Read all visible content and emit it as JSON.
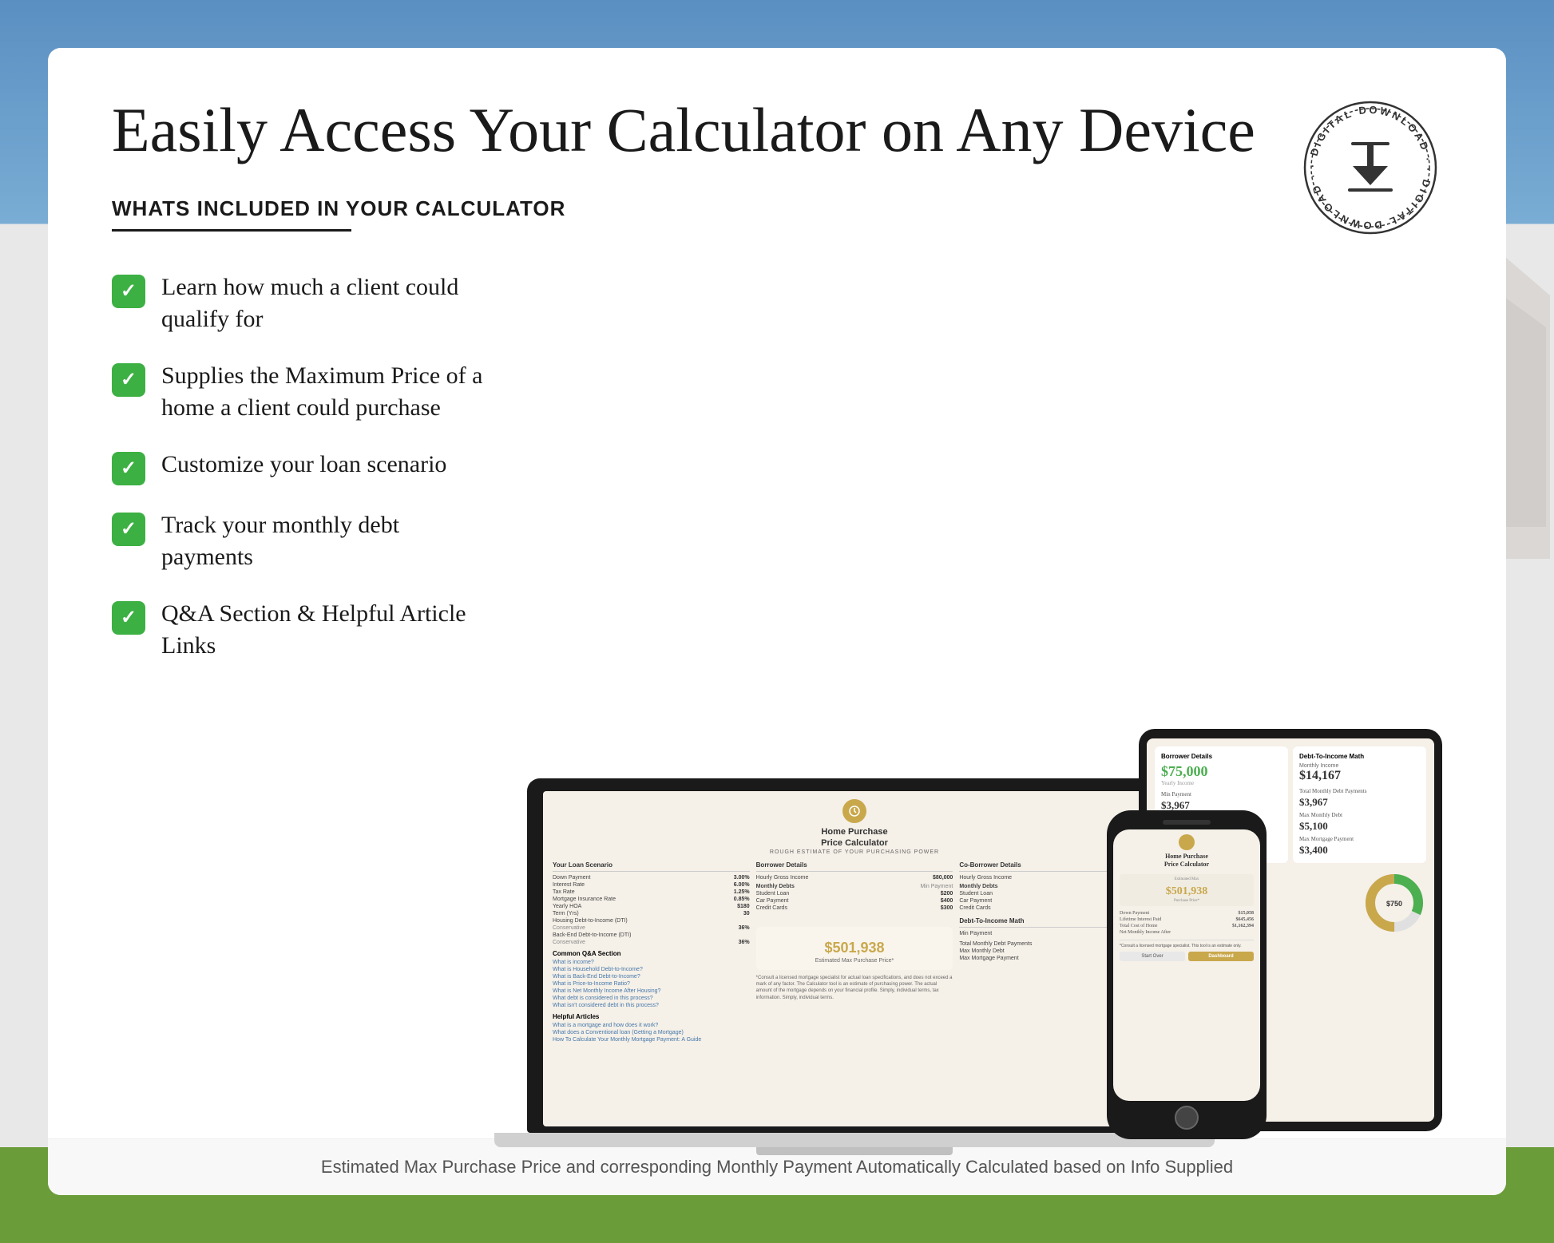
{
  "page": {
    "background": {
      "sky_color": "#5a8fc2",
      "card_bg": "#ffffff"
    },
    "headline": "Easily Access Your Calculator on Any Device",
    "section_title": "WHATS INCLUDED IN YOUR CALCULATOR",
    "features": [
      {
        "id": 1,
        "text": "Learn how much a client could qualify for"
      },
      {
        "id": 2,
        "text": "Supplies the Maximum Price of a home a client could purchase"
      },
      {
        "id": 3,
        "text": "Customize your loan scenario"
      },
      {
        "id": 4,
        "text": "Track your monthly debt payments"
      },
      {
        "id": 5,
        "text": "Q&A Section & Helpful Article Links"
      }
    ],
    "footer_note": "Estimated Max Purchase Price and corresponding Monthly Payment Automatically Calculated based on Info Supplied",
    "badge": {
      "text": "DIGITAL DOWNLOAD",
      "icon": "download"
    },
    "calculator": {
      "title": "Home Purchase Price Calculator",
      "subtitle": "ROUGH ESTIMATE OF YOUR PURCHASING POWER",
      "estimated_price": "$501,938",
      "estimated_label": "Estimated Max Purchase Price*",
      "sections": {
        "loan": {
          "title": "Your Loan Scenario",
          "rows": [
            {
              "label": "Down Payment",
              "value": "3.00%"
            },
            {
              "label": "Interest Rate",
              "value": "6.00%"
            },
            {
              "label": "Tax Rate",
              "value": "1.25%"
            },
            {
              "label": "Mortgage Insurance Rate",
              "value": "0.85%"
            },
            {
              "label": "Yearly HOA",
              "value": "$180"
            },
            {
              "label": "Term (Yrs)",
              "value": "30"
            },
            {
              "label": "Housing Debt-to-Income (DTI)",
              "value": "Conservative 36%"
            },
            {
              "label": "Back-End Debt-to-Income (DTI)",
              "value": "Conservative 36%"
            }
          ]
        },
        "borrower": {
          "title": "Borrower Details",
          "rows": [
            {
              "label": "Hourly Gross Income",
              "value": "$80,000"
            },
            {
              "label": "Monthly Debts",
              "value": ""
            },
            {
              "label": "Student Loan",
              "value": "$200"
            },
            {
              "label": "Car Payment",
              "value": "$400"
            },
            {
              "label": "Credit Cards",
              "value": "$300"
            }
          ]
        },
        "coborrower": {
          "title": "Co-Borrower Details",
          "rows": [
            {
              "label": "Hourly Gross Income",
              "value": ""
            },
            {
              "label": "Monthly Debts",
              "value": ""
            },
            {
              "label": "Student Loan",
              "value": ""
            },
            {
              "label": "Car Payment",
              "value": ""
            },
            {
              "label": "Credit Cards",
              "value": ""
            }
          ]
        },
        "dti": {
          "title": "Debt-To-Income Math",
          "min_payment": "$14,167",
          "total_monthly": "$3,967",
          "max_monthly_debt": "$5,100",
          "max_mortgage_payment": "$3,400"
        }
      },
      "qa": {
        "title": "Common Q&A Section",
        "items": [
          "What is income?",
          "What is Household Debt-to-Income?",
          "What is Back-End Debt-to-Income?",
          "What is Price-to-Income Ratio?",
          "What is Net Monthly Income After Housing?",
          "What debt is considered in this process?",
          "What isn't considered debt in this process?"
        ]
      },
      "articles": {
        "title": "Helpful Articles",
        "items": [
          "What is a mortgage and how does it work?",
          "What does a Conventional loan (Getting a Mortgage)",
          "How To Calculate Your Monthly Mortgage Payment: A Guide"
        ]
      }
    }
  }
}
